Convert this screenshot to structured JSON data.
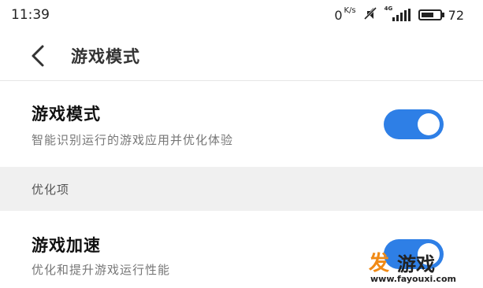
{
  "status": {
    "time": "11:39",
    "net_speed": "0",
    "net_unit": "K/s",
    "network_tag": "4G",
    "battery": "72",
    "battery_level": 0.72
  },
  "header": {
    "title": "游戏模式"
  },
  "game_mode": {
    "title": "游戏模式",
    "description": "智能识别运行的游戏应用并优化体验",
    "enabled": true
  },
  "section": {
    "label": "优化项"
  },
  "game_boost": {
    "title": "游戏加速",
    "description": "优化和提升游戏运行性能",
    "enabled": true
  },
  "watermark": {
    "logo": "发",
    "text": "游戏",
    "url": "www.fayouxi.com"
  },
  "colors": {
    "accent": "#2e7fe6",
    "section_bg": "#f0f0f0",
    "watermark_orange": "#f08a16"
  }
}
